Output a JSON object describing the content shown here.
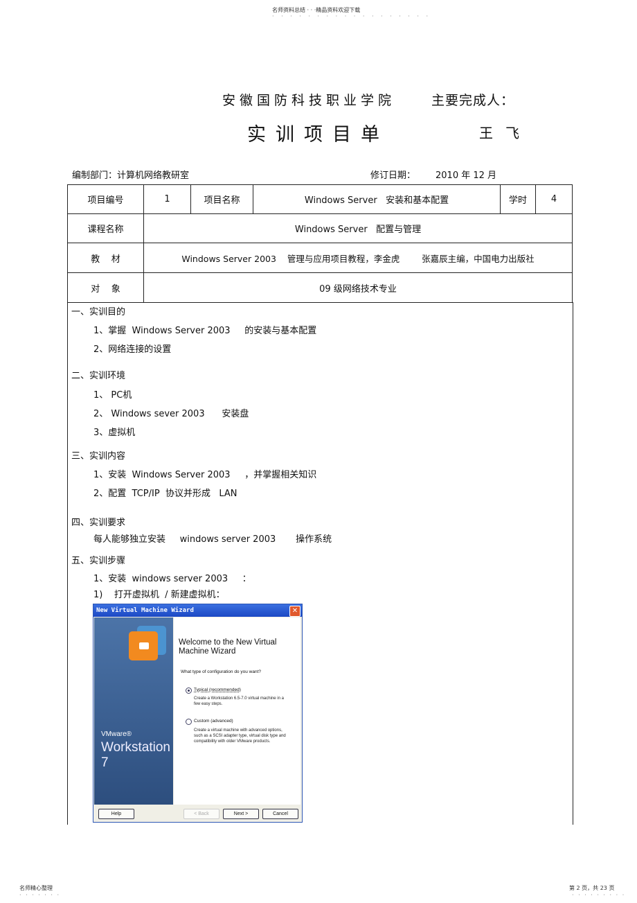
{
  "header": {
    "watermark": "名师资料总结 · · ·精品资料欢迎下载",
    "dots": "· · · · · · · · · · · · · · · · · ·"
  },
  "title": {
    "school": "安徽国防科技职业学院",
    "completer_label": "主要完成人：",
    "doc_title": "实训项目单",
    "completer_name": "王飞"
  },
  "meta": {
    "dept": "编制部门：计算机网络教研室",
    "date_label": "修订日期：",
    "date": "2010 年 12 月"
  },
  "table": {
    "project_no_label": "项目编号",
    "project_no": "1",
    "project_name_label": "项目名称",
    "project_name": "Windows Server   安装和基本配置",
    "hours_label": "学时",
    "hours": "4",
    "course_label": "课程名称",
    "course": "Windows Server   配置与管理",
    "textbook_label": "教    材",
    "textbook": "Windows Server 2003    管理与应用项目教程，李金虎        张嘉辰主编，中国电力出版社",
    "target_label": "对    象",
    "target": "09 级网络技术专业"
  },
  "sections": [
    {
      "heading": "一、实训目的",
      "items": [
        "1、掌握  Windows Server 2003     的安装与基本配置",
        "2、网络连接的设置"
      ]
    },
    {
      "heading": "二、实训环境",
      "items": [
        "1、 PC机",
        "2、 Windows sever 2003      安装盘",
        "3、虚拟机"
      ]
    },
    {
      "heading": "三、实训内容",
      "items": [
        "1、安装  Windows Server 2003     ，并掌握相关知识",
        "2、配置  TCP/IP  协议并形成   LAN"
      ]
    },
    {
      "heading": "四、实训要求",
      "items": [
        "每人能够独立安装     windows server 2003       操作系统"
      ]
    },
    {
      "heading": "五、实训步骤",
      "items": [
        "1、安装  windows server 2003     ：",
        "1)    打开虚拟机  / 新建虚拟机："
      ]
    }
  ],
  "dialog": {
    "title": "New Virtual Machine Wizard",
    "close": "✕",
    "brand": "VMware®",
    "product": "Workstation 7",
    "heading": "Welcome to the New Virtual Machine Wizard",
    "question": "What type of configuration do you want?",
    "options": [
      {
        "label": "Typical (recommended)",
        "desc": "Create a Workstation 6.5-7.0 virtual machine in a few easy steps.",
        "selected": true
      },
      {
        "label": "Custom (advanced)",
        "desc": "Create a virtual machine with advanced options, such as a SCSI adapter type, virtual disk type and compatibility with older VMware products.",
        "selected": false
      }
    ],
    "buttons": {
      "help": "Help",
      "back": "< Back",
      "next": "Next >",
      "cancel": "Cancel"
    }
  },
  "footer": {
    "left": "名师精心整理",
    "left_dots": "· · · · · · ·",
    "right": "第 2 页，共 23 页",
    "right_dots": "· · · · · · · · ·"
  }
}
